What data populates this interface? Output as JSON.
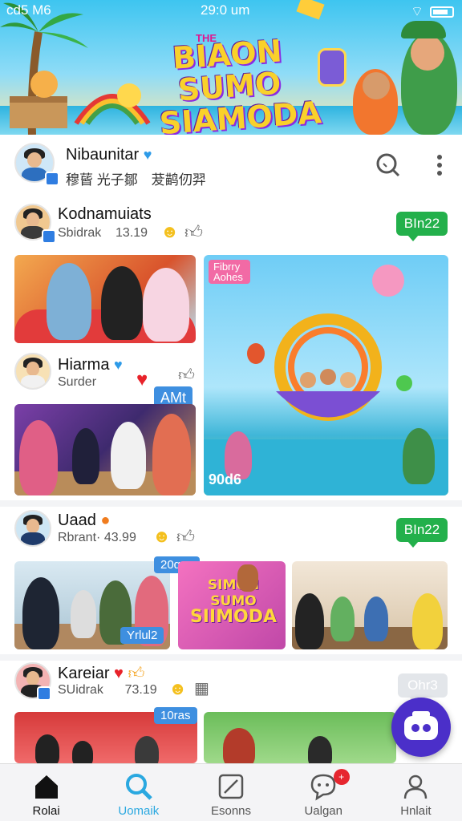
{
  "status_bar": {
    "left": "cd5 M6",
    "time": "29:0 um"
  },
  "banner": {
    "title_line1": "BIAON SUMO",
    "title_line2": "SIAMODA",
    "subtitle": "THE"
  },
  "profile": {
    "name": "Nibaunitar",
    "subtitle": "穆蒈 光子鄒　茇鹋仞羿"
  },
  "posts": [
    {
      "name": "Kodnamuiats",
      "meta": "Sbidrak",
      "count": "13.19",
      "badge": "BIn22",
      "badge_color": "#23b04b"
    },
    {
      "name": "Hiarma",
      "meta": "Surder",
      "card_tag": "AMt",
      "tag_overlay": "90d6",
      "poster_label": "Fibrry Aohes"
    },
    {
      "name": "Uaad",
      "meta": "Rbrant·",
      "count": "43.99",
      "badge": "BIn22",
      "badge_color": "#23b04b",
      "photo_tag_1": "20qus",
      "photo_tag_2": "Yrlul2"
    },
    {
      "name": "Kareiar",
      "meta": "SUidrak",
      "count": "73.19",
      "badge": "Ohr3",
      "badge_color": "#e3e6ea",
      "photo_tag": "10ras"
    }
  ],
  "poster_mini": {
    "line1": "SIMON SUMO",
    "line2": "SIIMODA"
  },
  "nav": [
    {
      "label": "Rolai",
      "icon": "home-icon"
    },
    {
      "label": "Uomaik",
      "icon": "search-icon"
    },
    {
      "label": "Esonns",
      "icon": "edit-icon"
    },
    {
      "label": "Ualgan",
      "icon": "chat-icon",
      "badge": "+"
    },
    {
      "label": "Hnlait",
      "icon": "profile-icon"
    }
  ],
  "colors": {
    "accent": "#2aa8e0",
    "green": "#23b04b",
    "fab": "#4b2fc9"
  }
}
